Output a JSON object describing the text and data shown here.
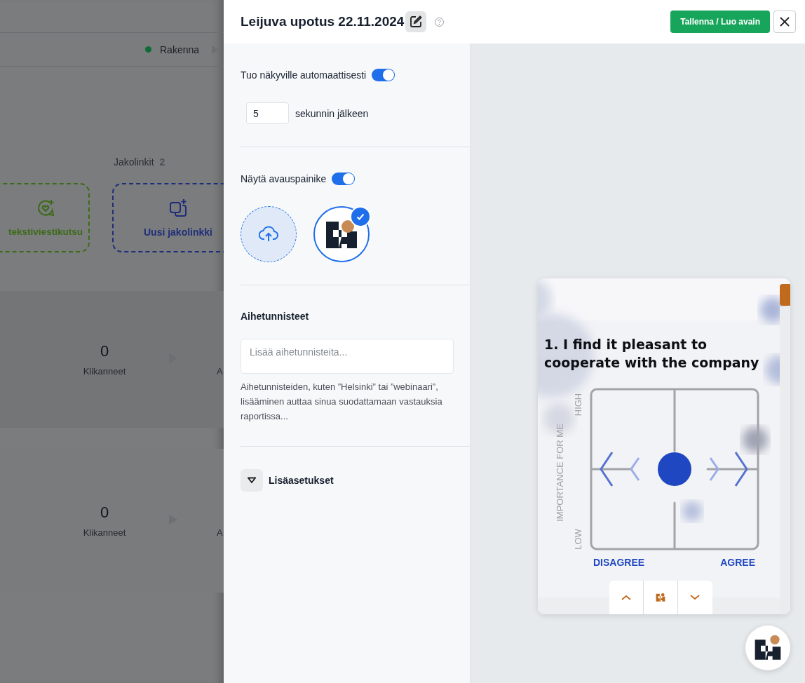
{
  "background_page": {
    "status": {
      "label": "Rakenna"
    },
    "share_links": {
      "title": "Jakolinkit",
      "count": "2",
      "cards": [
        {
          "kind": "sms",
          "label": "tekstiviestikutsu"
        },
        {
          "kind": "link",
          "label": "Uusi jakolinkki"
        }
      ]
    },
    "stats": [
      {
        "value": "0",
        "label": "Klikanneet",
        "next_label": "A"
      },
      {
        "value": "0",
        "label": "Klikanneet",
        "next_label": "A"
      }
    ]
  },
  "drawer": {
    "title": "Leijuva upotus 22.11.2024",
    "save_button": "Tallenna / Luo avain"
  },
  "settings": {
    "auto_show": {
      "label": "Tuo näkyville automaattisesti",
      "on": true
    },
    "delay": {
      "value": "5",
      "suffix": "sekunnin jälkeen"
    },
    "launcher": {
      "label": "Näytä avauspainike",
      "on": true,
      "options": [
        {
          "kind": "upload",
          "selected": false
        },
        {
          "kind": "logo",
          "selected": true
        }
      ]
    },
    "tags": {
      "title": "Aihetunnisteet",
      "placeholder": "Lisää aihetunnisteita...",
      "help": "Aihetunnisteiden, kuten ”Helsinki” tai ”webinaari”, lisääminen auttaa sinua suodattamaan vastauksia raportissa..."
    },
    "advanced": {
      "label": "Lisäasetukset",
      "expanded": false
    }
  },
  "preview": {
    "question": "1. I find it pleasant to cooperate with the company",
    "y_axis": "IMPORTANCE FOR ME",
    "y_high": "HIGH",
    "y_low": "LOW",
    "x_left": "DISAGREE",
    "x_right": "AGREE"
  }
}
